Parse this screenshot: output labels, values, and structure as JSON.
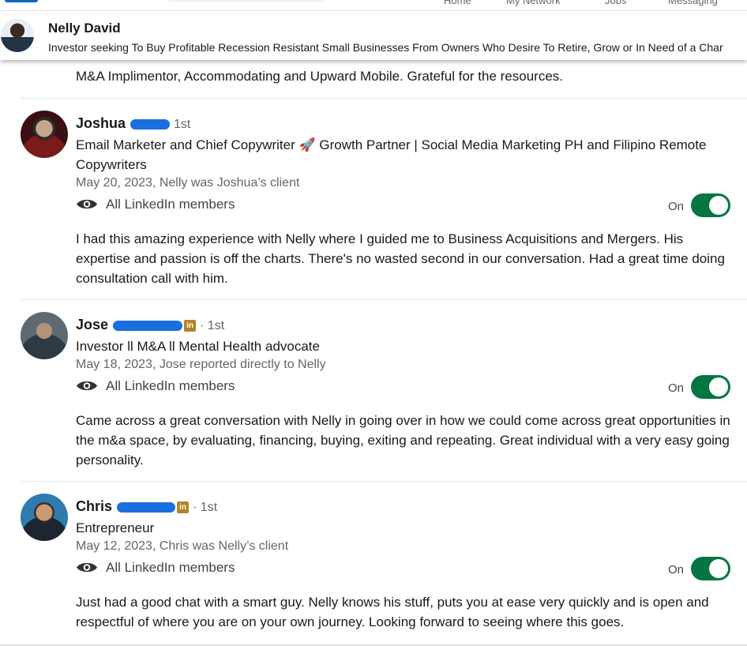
{
  "topnav": {
    "links": [
      "Home",
      "My Network",
      "Jobs",
      "Messaging"
    ]
  },
  "profile_header": {
    "name": "Nelly David",
    "headline": "Investor seeking To Buy Profitable Recession Resistant Small Businesses From Owners Who Desire To Retire, Grow or In Need of a Char"
  },
  "previous_tail": "M&A Implimentor, Accommodating and Upward Mobile. Grateful for the resources.",
  "recommendations": [
    {
      "name": "Joshua",
      "degree": "1st",
      "headline": "Email Marketer and Chief Copywriter 🚀 Growth Partner | Social Media Marketing PH and Filipino Remote Copywriters",
      "date": "May 20, 2023, Nelly was Joshua’s client",
      "visibility": "All LinkedIn members",
      "toggle_label": "On",
      "text": "I had this amazing experience with Nelly where I guided me to Business Acquisitions and Mergers. His expertise and passion is off the charts. There's no wasted second in our conversation. Had a great time doing consultation call with him."
    },
    {
      "name": "Jose",
      "degree": "· 1st",
      "li_badge": "in",
      "headline": "Investor ll M&A ll Mental Health advocate",
      "date": "May 18, 2023, Jose reported directly to Nelly",
      "visibility": "All LinkedIn members",
      "toggle_label": "On",
      "text": "Came across a great conversation with Nelly in going over in how we could come across great opportunities in the m&a space, by evaluating, financing, buying, exiting and repeating. Great individual with a very easy going personality."
    },
    {
      "name": "Chris",
      "degree": "· 1st",
      "li_badge": "in",
      "headline": "Entrepreneur",
      "date": "May 12, 2023, Chris was Nelly’s client",
      "visibility": "All LinkedIn members",
      "toggle_label": "On",
      "text": "Just had a good chat with a smart guy. Nelly knows his stuff, puts you at ease very quickly and is open and respectful of where you are on your own journey. Looking forward to seeing where this goes."
    }
  ],
  "colors": {
    "toggle_on": "#057642",
    "redaction": "#1a6fe0",
    "premium_badge": "#b5832b"
  },
  "icons": {
    "visibility": "eye-icon",
    "more": "kebab-icon"
  },
  "toggles_on": [
    true,
    true,
    true
  ]
}
